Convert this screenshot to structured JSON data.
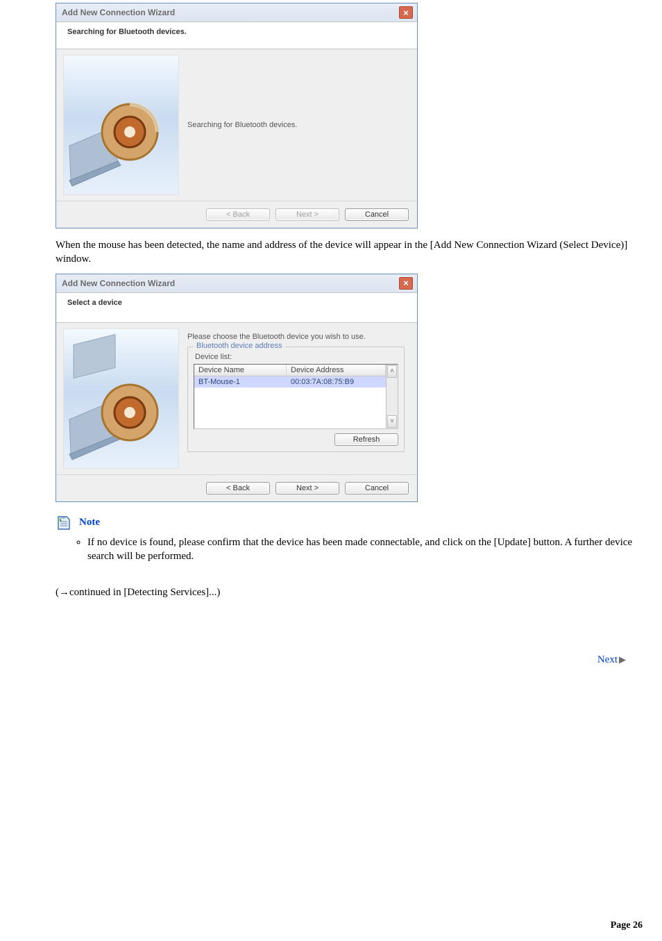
{
  "dialog1": {
    "title": "Add New Connection Wizard",
    "subheader": "Searching for Bluetooth devices.",
    "body_text": "Searching for Bluetooth devices.",
    "buttons": {
      "back": "< Back",
      "next": "Next >",
      "cancel": "Cancel"
    }
  },
  "paragraph1": "When the mouse has been detected, the name and address of the device will appear in the [Add New Connection Wizard (Select Device)] window.",
  "dialog2": {
    "title": "Add New Connection Wizard",
    "subheader": "Select a device",
    "instruction": "Please choose the Bluetooth device you wish to use.",
    "group_legend": "Bluetooth device address",
    "list_label": "Device list:",
    "columns": {
      "name": "Device Name",
      "address": "Device Address"
    },
    "row": {
      "name": "BT-Mouse-1",
      "address": "00:03:7A:08:75:B9"
    },
    "refresh": "Refresh",
    "buttons": {
      "back": "< Back",
      "next": "Next >",
      "cancel": "Cancel"
    }
  },
  "note": {
    "label": "Note",
    "item1": "If no device is found, please confirm that the device has been made connectable, and click on the [Update] button. A further device search will be performed."
  },
  "continued": "(→continued in [Detecting Services]...)",
  "next_label": "Next",
  "page_footer": "Page 26"
}
